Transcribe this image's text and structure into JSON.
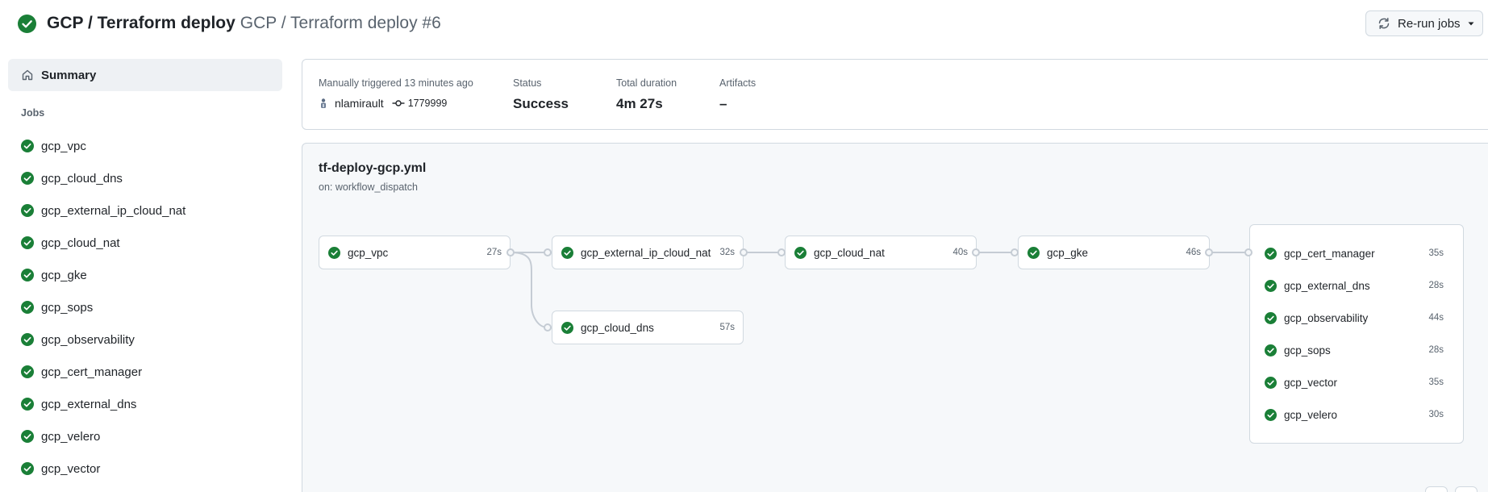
{
  "header": {
    "workflow_name": "GCP / Terraform deploy",
    "run_title": "GCP / Terraform deploy #6",
    "status_icon": "check-circle-fill-icon",
    "rerun_label": "Re-run jobs"
  },
  "sidebar": {
    "summary_label": "Summary",
    "jobs_heading": "Jobs",
    "jobs": [
      {
        "label": "gcp_vpc"
      },
      {
        "label": "gcp_cloud_dns"
      },
      {
        "label": "gcp_external_ip_cloud_nat"
      },
      {
        "label": "gcp_cloud_nat"
      },
      {
        "label": "gcp_gke"
      },
      {
        "label": "gcp_sops"
      },
      {
        "label": "gcp_observability"
      },
      {
        "label": "gcp_cert_manager"
      },
      {
        "label": "gcp_external_dns"
      },
      {
        "label": "gcp_velero"
      },
      {
        "label": "gcp_vector"
      }
    ]
  },
  "summary": {
    "trigger_label": "Manually triggered 13 minutes ago",
    "actor": "nlamirault",
    "commit": "1779999",
    "status_label": "Status",
    "status_value": "Success",
    "duration_label": "Total duration",
    "duration_value": "4m 27s",
    "artifacts_label": "Artifacts",
    "artifacts_value": "–"
  },
  "graph": {
    "file": "tf-deploy-gcp.yml",
    "trigger": "on: workflow_dispatch",
    "nodes": [
      {
        "label": "gcp_vpc",
        "duration": "27s"
      },
      {
        "label": "gcp_external_ip_cloud_nat",
        "duration": "32s"
      },
      {
        "label": "gcp_cloud_dns",
        "duration": "57s"
      },
      {
        "label": "gcp_cloud_nat",
        "duration": "40s"
      },
      {
        "label": "gcp_gke",
        "duration": "46s"
      }
    ],
    "group": [
      {
        "label": "gcp_cert_manager",
        "duration": "35s"
      },
      {
        "label": "gcp_external_dns",
        "duration": "28s"
      },
      {
        "label": "gcp_observability",
        "duration": "44s"
      },
      {
        "label": "gcp_sops",
        "duration": "28s"
      },
      {
        "label": "gcp_vector",
        "duration": "35s"
      },
      {
        "label": "gcp_velero",
        "duration": "30s"
      }
    ]
  },
  "colors": {
    "success": "#1a7f37",
    "border": "#d1d9e0",
    "muted_text": "#59636e",
    "canvas_bg": "#f6f8fa"
  }
}
